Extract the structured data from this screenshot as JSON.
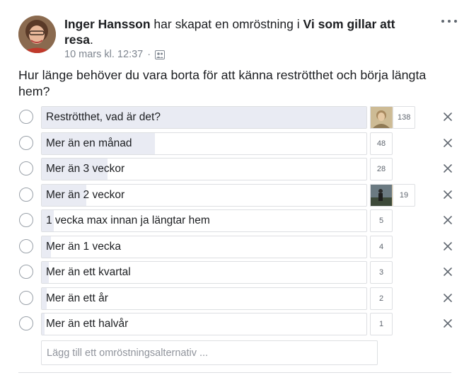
{
  "post": {
    "author": "Inger Hansson",
    "action_text": " har skapat en omröstning i ",
    "group": "Vi som gillar att resa",
    "group_suffix": ".",
    "timestamp": "10 mars kl. 12:37",
    "separator": "·",
    "audience_icon": "group-icon",
    "more_icon": "more-options-icon"
  },
  "poll": {
    "question": "Hur länge behöver du vara borta för att känna reströtthet och börja längta hem?",
    "total_max": 138,
    "options": [
      {
        "label": "Reströtthet, vad är det?",
        "votes": 138,
        "count": "138",
        "has_voter_thumb": true
      },
      {
        "label": "Mer än en månad",
        "votes": 48,
        "count": "48",
        "has_voter_thumb": false
      },
      {
        "label": "Mer än 3 veckor",
        "votes": 28,
        "count": "28",
        "has_voter_thumb": false
      },
      {
        "label": "Mer än 2 veckor",
        "votes": 19,
        "count": "19",
        "has_voter_thumb": true
      },
      {
        "label": "1 vecka max innan ja längtar hem",
        "votes": 5,
        "count": "5",
        "has_voter_thumb": false
      },
      {
        "label": "Mer än 1 vecka",
        "votes": 4,
        "count": "4",
        "has_voter_thumb": false
      },
      {
        "label": "Mer än ett kvartal",
        "votes": 3,
        "count": "3",
        "has_voter_thumb": false
      },
      {
        "label": "Mer än ett år",
        "votes": 2,
        "count": "2",
        "has_voter_thumb": false
      },
      {
        "label": "Mer än ett halvår",
        "votes": 1,
        "count": "1",
        "has_voter_thumb": false
      }
    ],
    "add_option_placeholder": "Lägg till ett omröstningsalternativ ..."
  },
  "colors": {
    "fill": "#e9ebf3",
    "border": "#dddfe2",
    "meta_text": "#7f8690"
  }
}
